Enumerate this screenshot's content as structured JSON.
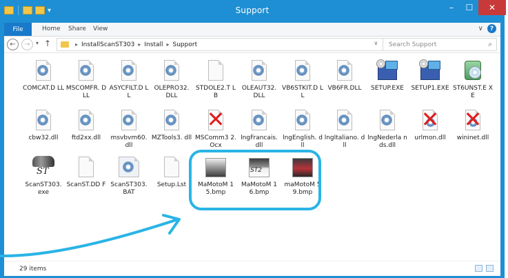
{
  "window": {
    "title": "Support",
    "controls": {
      "minimize": "–",
      "maximize": "☐",
      "close": "✕"
    }
  },
  "ribbon": {
    "file_tab": "File",
    "tabs": [
      "Home",
      "Share",
      "View"
    ],
    "help": "?"
  },
  "navigation": {
    "path": [
      "InstallScanST303",
      "Install",
      "Support"
    ],
    "search_placeholder": "Search Support"
  },
  "files": [
    {
      "name": "COMCAT.DLL",
      "label": "COMCAT.D LL",
      "icon": "dll-gear-icon"
    },
    {
      "name": "MSCOMFR.DLL",
      "label": "MSCOMFR. DLL",
      "icon": "dll-gear-icon"
    },
    {
      "name": "ASYCFILT.DLL",
      "label": "ASYCFILT.D LL",
      "icon": "dll-gear-icon"
    },
    {
      "name": "OLEPRO32.DLL",
      "label": "OLEPRO32. DLL",
      "icon": "dll-gear-icon"
    },
    {
      "name": "STDOLE2.TLB",
      "label": "STDOLE2.T LB",
      "icon": "blank-file-icon"
    },
    {
      "name": "OLEAUT32.DLL",
      "label": "OLEAUT32. DLL",
      "icon": "dll-gear-icon"
    },
    {
      "name": "VB6STKIT.DLL",
      "label": "VB6STKIT.D LL",
      "icon": "dll-gear-icon"
    },
    {
      "name": "VB6FR.DLL",
      "label": "VB6FR.DLL",
      "icon": "dll-gear-icon"
    },
    {
      "name": "SETUP.EXE",
      "label": "SETUP.EXE",
      "icon": "setup-installer-icon"
    },
    {
      "name": "SETUP1.EXE",
      "label": "SETUP1.EXE",
      "icon": "setup-installer-icon"
    },
    {
      "name": "ST6UNST.EXE",
      "label": "ST6UNST.E XE",
      "icon": "uninstaller-icon"
    },
    {
      "name": "cbw32.dll",
      "label": "cbw32.dll",
      "icon": "dll-gear-icon"
    },
    {
      "name": "ftd2xx.dll",
      "label": "ftd2xx.dll",
      "icon": "dll-gear-icon"
    },
    {
      "name": "msvbvm60.dll",
      "label": "msvbvm60. dll",
      "icon": "dll-gear-icon"
    },
    {
      "name": "MZTools3.dll",
      "label": "MZTools3. dll",
      "icon": "dll-gear-icon"
    },
    {
      "name": "MSComm32.Ocx",
      "label": "MSComm3 2.Ocx",
      "icon": "red-x-icon"
    },
    {
      "name": "lngFrancais.dll",
      "label": "lngFrancais. dll",
      "icon": "dll-gear-icon"
    },
    {
      "name": "lngEnglish.dll",
      "label": "lngEnglish. dll",
      "icon": "dll-gear-icon"
    },
    {
      "name": "lngItaliano.dll",
      "label": "lngItaliano. dll",
      "icon": "dll-gear-icon"
    },
    {
      "name": "lngNederlands.dll",
      "label": "lngNederla nds.dll",
      "icon": "dll-gear-icon"
    },
    {
      "name": "urlmon.dll",
      "label": "urlmon.dll",
      "icon": "red-x-icon"
    },
    {
      "name": "wininet.dll",
      "label": "wininet.dll",
      "icon": "red-x-icon"
    },
    {
      "name": "ScanST303.exe",
      "label": "ScanST303. exe",
      "icon": "motorcycle-st-exe-icon"
    },
    {
      "name": "ScanST.DDF",
      "label": "ScanST.DD F",
      "icon": "blank-file-icon"
    },
    {
      "name": "ScanST303.BAT",
      "label": "ScanST303. BAT",
      "icon": "batch-gear-icon"
    },
    {
      "name": "Setup.Lst",
      "label": "Setup.Lst",
      "icon": "blank-file-icon"
    },
    {
      "name": "MaMotoM15.bmp",
      "label": "MaMotoM 15.bmp",
      "icon": "motorcycle-bitmap-icon"
    },
    {
      "name": "MaMotoM16.bmp",
      "label": "MaMotoM 16.bmp",
      "icon": "motorcycle-st2-bitmap-icon"
    },
    {
      "name": "maMotoM59.bmp",
      "label": "maMotoM 59.bmp",
      "icon": "red-motorcycle-bitmap-icon"
    }
  ],
  "icon_thumb_texts": {
    "st2": "ST2"
  },
  "exe_thumb_text": "ST",
  "status": {
    "item_count": "29 items"
  },
  "annotation": {
    "color": "#2ab4e6"
  }
}
